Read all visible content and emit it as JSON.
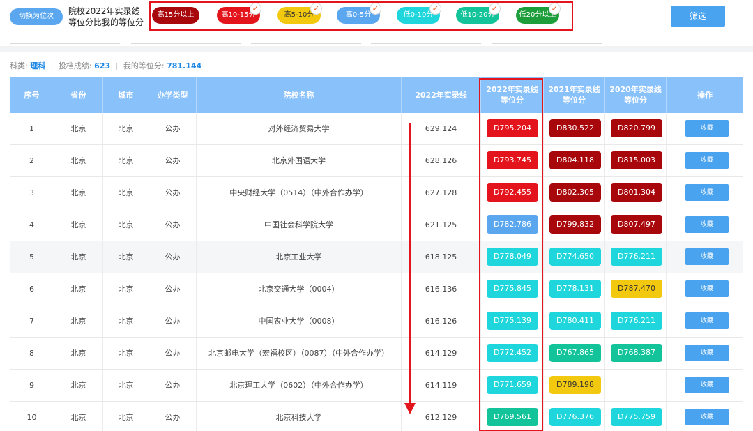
{
  "toolbar": {
    "switch_label": "切换为位次",
    "description_line1": "院校2022年实录线",
    "description_line2": "等位分比我的等位分",
    "filter_label": "筛选",
    "legend": [
      {
        "label": "高15分以上",
        "color": "#a8070c",
        "checked": false
      },
      {
        "label": "高10-15分",
        "color": "#e3141c",
        "checked": true
      },
      {
        "label": "高5-10分",
        "color": "#f3c910",
        "checked": true
      },
      {
        "label": "高0-5分",
        "color": "#5aa7f0",
        "checked": true
      },
      {
        "label": "低0-10分",
        "color": "#1fd6dc",
        "checked": true
      },
      {
        "label": "低10-20分",
        "color": "#13c39a",
        "checked": true
      },
      {
        "label": "低20分以上",
        "color": "#1e9e3a",
        "checked": true
      }
    ]
  },
  "info": {
    "subject_label": "科类:",
    "subject_value": "理科",
    "score_label": "投档成绩:",
    "score_value": "623",
    "rank_label": "我的等位分:",
    "rank_value": "781.144"
  },
  "table": {
    "headers": {
      "index": "序号",
      "province": "省份",
      "city": "城市",
      "type": "办学类型",
      "school": "院校名称",
      "score_2022": "2022年实录线",
      "eq_2022_line1": "2022年实录线",
      "eq_2022_line2": "等位分",
      "eq_2021_line1": "2021年实录线",
      "eq_2021_line2": "等位分",
      "eq_2020_line1": "2020年实录线",
      "eq_2020_line2": "等位分",
      "action": "操作"
    },
    "action_label": "收藏",
    "rows": [
      {
        "index": "1",
        "province": "北京",
        "city": "北京",
        "type": "公办",
        "school": "对外经济贸易大学",
        "score": "629.124",
        "eq2022": "D795.204",
        "eq2022_color": "#e3141c",
        "eq2021": "D830.522",
        "eq2021_color": "#a8070c",
        "eq2020": "D820.799",
        "eq2020_color": "#a8070c"
      },
      {
        "index": "2",
        "province": "北京",
        "city": "北京",
        "type": "公办",
        "school": "北京外国语大学",
        "score": "628.126",
        "eq2022": "D793.745",
        "eq2022_color": "#e3141c",
        "eq2021": "D804.118",
        "eq2021_color": "#a8070c",
        "eq2020": "D815.003",
        "eq2020_color": "#a8070c"
      },
      {
        "index": "3",
        "province": "北京",
        "city": "北京",
        "type": "公办",
        "school": "中央财经大学（0514）（中外合作办学）",
        "score": "627.128",
        "eq2022": "D792.455",
        "eq2022_color": "#e3141c",
        "eq2021": "D802.305",
        "eq2021_color": "#a8070c",
        "eq2020": "D801.304",
        "eq2020_color": "#a8070c"
      },
      {
        "index": "4",
        "province": "北京",
        "city": "北京",
        "type": "公办",
        "school": "中国社会科学院大学",
        "score": "621.125",
        "eq2022": "D782.786",
        "eq2022_color": "#5aa7f0",
        "eq2021": "D799.832",
        "eq2021_color": "#a8070c",
        "eq2020": "D807.497",
        "eq2020_color": "#a8070c"
      },
      {
        "index": "5",
        "province": "北京",
        "city": "北京",
        "type": "公办",
        "school": "北京工业大学",
        "score": "618.125",
        "eq2022": "D778.049",
        "eq2022_color": "#1fd6dc",
        "eq2021": "D774.650",
        "eq2021_color": "#1fd6dc",
        "eq2020": "D776.211",
        "eq2020_color": "#1fd6dc"
      },
      {
        "index": "6",
        "province": "北京",
        "city": "北京",
        "type": "公办",
        "school": "北京交通大学（0004）",
        "score": "616.136",
        "eq2022": "D775.845",
        "eq2022_color": "#1fd6dc",
        "eq2021": "D778.131",
        "eq2021_color": "#1fd6dc",
        "eq2020": "D787.470",
        "eq2020_color": "#f3c910"
      },
      {
        "index": "7",
        "province": "北京",
        "city": "北京",
        "type": "公办",
        "school": "中国农业大学（0008）",
        "score": "616.126",
        "eq2022": "D775.139",
        "eq2022_color": "#1fd6dc",
        "eq2021": "D780.411",
        "eq2021_color": "#1fd6dc",
        "eq2020": "D776.211",
        "eq2020_color": "#1fd6dc"
      },
      {
        "index": "8",
        "province": "北京",
        "city": "北京",
        "type": "公办",
        "school": "北京邮电大学（宏福校区）（0087）（中外合作办学）",
        "score": "614.129",
        "eq2022": "D772.452",
        "eq2022_color": "#1fd6dc",
        "eq2021": "D767.865",
        "eq2021_color": "#13c39a",
        "eq2020": "D768.387",
        "eq2020_color": "#13c39a"
      },
      {
        "index": "9",
        "province": "北京",
        "city": "北京",
        "type": "公办",
        "school": "北京理工大学（0602）（中外合作办学）",
        "score": "614.119",
        "eq2022": "D771.659",
        "eq2022_color": "#1fd6dc",
        "eq2021": "D789.198",
        "eq2021_color": "#f3c910",
        "eq2020": "",
        "eq2020_color": ""
      },
      {
        "index": "10",
        "province": "北京",
        "city": "北京",
        "type": "公办",
        "school": "北京科技大学",
        "score": "612.129",
        "eq2022": "D769.561",
        "eq2022_color": "#13c39a",
        "eq2021": "D776.376",
        "eq2021_color": "#1fd6dc",
        "eq2020": "D775.759",
        "eq2020_color": "#1fd6dc"
      }
    ]
  }
}
